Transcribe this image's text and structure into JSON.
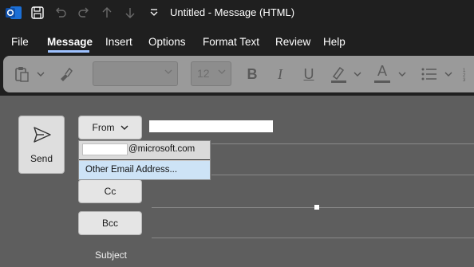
{
  "window": {
    "title": "Untitled  -  Message (HTML)"
  },
  "icons": {
    "app": "outlook-icon",
    "save": "save-icon",
    "undo": "undo-icon",
    "redo": "redo-icon",
    "up": "up-arrow-icon",
    "down": "down-arrow-icon",
    "customize": "customize-quick-access-icon"
  },
  "menu": {
    "items": [
      {
        "label": "File"
      },
      {
        "label": "Message"
      },
      {
        "label": "Insert"
      },
      {
        "label": "Options"
      },
      {
        "label": "Format Text"
      },
      {
        "label": "Review"
      },
      {
        "label": "Help"
      }
    ],
    "active": "Message"
  },
  "ribbon": {
    "font_name": "",
    "font_size": "12",
    "bold": "B",
    "italic": "I",
    "underline": "U",
    "font_color": "A"
  },
  "compose": {
    "send_label": "Send",
    "from_label": "From",
    "cc_label": "Cc",
    "bcc_label": "Bcc",
    "subject_label": "Subject"
  },
  "from_dropdown": {
    "account_suffix": "@microsoft.com",
    "other_label": "Other Email Address..."
  },
  "colors": {
    "titlebar": "#1f1f1f",
    "ribbon": "#9a9a9a",
    "body": "#5e5e5e",
    "accent": "#9ec2ff",
    "highlight": "#cde3f6"
  }
}
